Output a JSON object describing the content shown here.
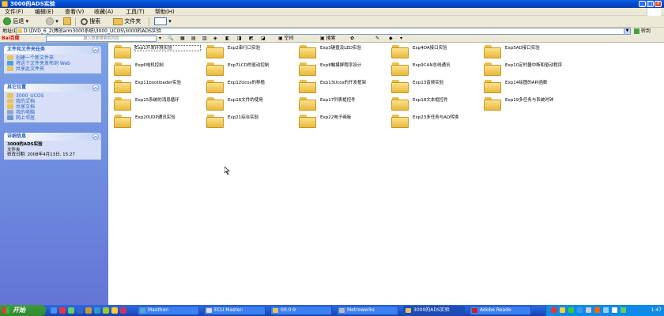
{
  "window": {
    "title": "3000的ADS实验"
  },
  "menu": [
    "文件(F)",
    "编辑(E)",
    "查看(V)",
    "收藏(A)",
    "工具(T)",
    "帮助(H)"
  ],
  "toolbar": {
    "back": "后退",
    "search": "搜索",
    "folders": "文件夹"
  },
  "address": {
    "label": "地址(D)",
    "value": "D:\\DVD_6_2\\博创arm3000系统\\3000_UCOS\\3000的ADS实验",
    "go": "转到"
  },
  "baidubar": {
    "logo": "Bai百度",
    "placeholder": "输入想要搜索的内容",
    "items": [
      "空间",
      "搜索"
    ]
  },
  "taskpane": {
    "file_tasks": {
      "title": "文件和文件夹任务",
      "links": [
        "创建一个新文件夹",
        "将这个文件夹发布到 Web",
        "共享此文件夹"
      ]
    },
    "other_places": {
      "title": "其它位置",
      "links": [
        "3000_UCOS",
        "我的文档",
        "共享文档",
        "我的电脑",
        "网上邻居"
      ]
    },
    "details": {
      "title": "详细信息",
      "name": "3000的ADS实验",
      "type": "文件夹",
      "modified": "修改日期: 2008年4月13日, 15:27"
    }
  },
  "folders": [
    "Exp1开发环境实验",
    "Exp2串行口实验",
    "Exp3键盘及LED实验",
    "Exp4DA接口实验",
    "Exp5AD接口实验",
    "Exp6电机控制",
    "Exp7LCD的驱动控制",
    "Exp8触摸屏程序设计",
    "Exp9CAN总线通讯",
    "Exp10定时器中断和驱动程序",
    "Exp11bootloader实验",
    "Exp12Ucos的移植",
    "Exp13Ucos的开发框架",
    "Exp13音频实验",
    "Exp14绘图的API函数",
    "Exp15系统的消息循环",
    "Exp16文件的使用",
    "Exp17列表框控件",
    "Exp18文本框控件",
    "Exp19多任务与系统时钟",
    "Exp20UDP通讯实验",
    "Exp21综合实验",
    "Exp22电子画板",
    "Exp23多任务与AD转换"
  ],
  "taskbar": {
    "start": "开始",
    "tasks": [
      "Maxthon",
      "ECU Master:",
      "00.0.9",
      "Metrowerks",
      "3000的ADS实验",
      "Adobe Reade"
    ],
    "clock": "1:47"
  }
}
